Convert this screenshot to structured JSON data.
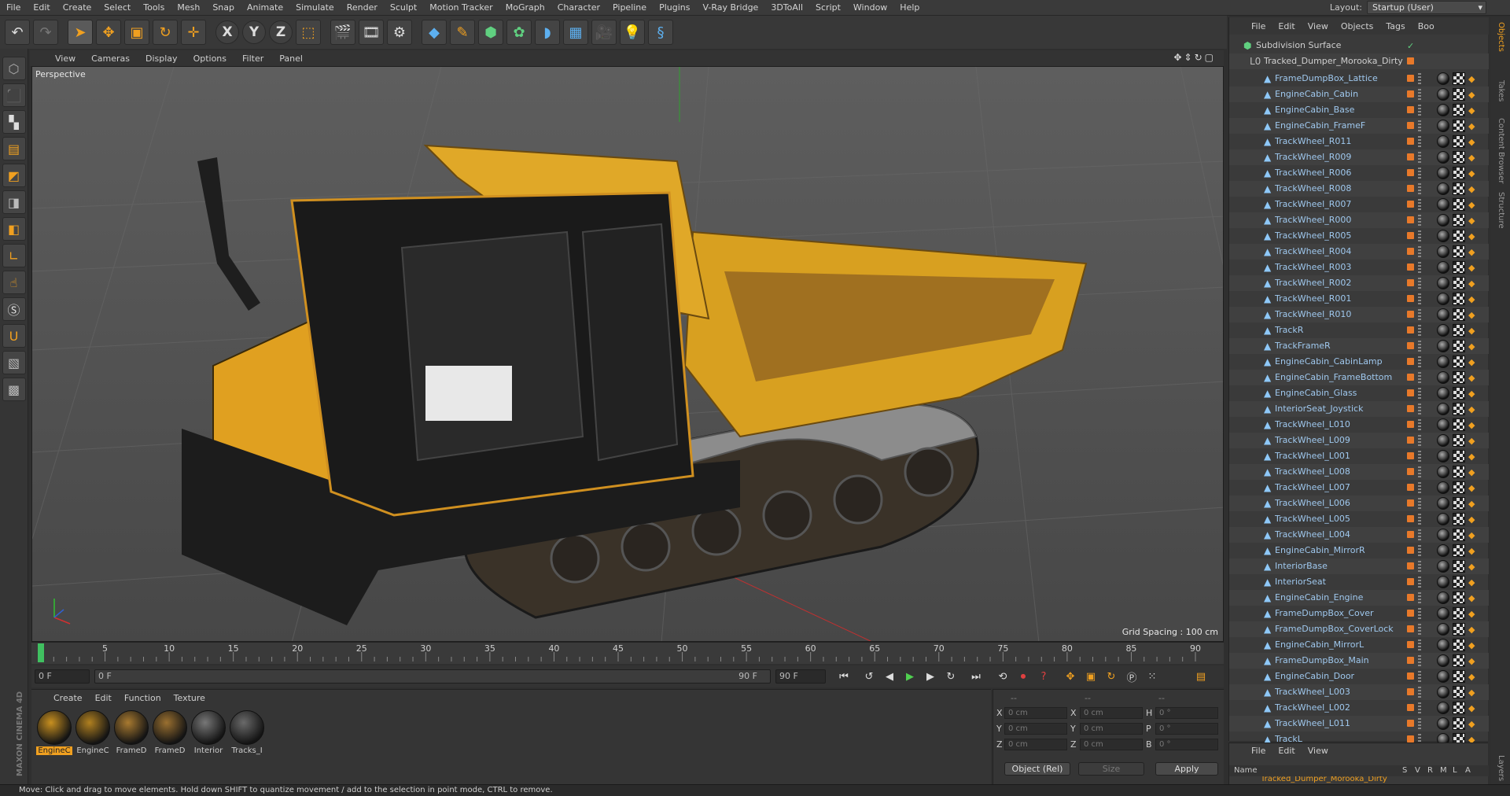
{
  "menubar": {
    "items": [
      "File",
      "Edit",
      "Create",
      "Select",
      "Tools",
      "Mesh",
      "Snap",
      "Animate",
      "Simulate",
      "Render",
      "Sculpt",
      "Motion Tracker",
      "MoGraph",
      "Character",
      "Pipeline",
      "Plugins",
      "V-Ray Bridge",
      "3DToAll",
      "Script",
      "Window",
      "Help"
    ],
    "layout_label": "Layout:",
    "layout_value": "Startup (User)"
  },
  "toolbar": {
    "icons": [
      "undo-icon",
      "redo-icon",
      "select-arrow-icon",
      "move-icon",
      "scale-icon",
      "rotate-icon",
      "live-select-icon",
      "x-axis-icon",
      "y-axis-icon",
      "z-axis-icon",
      "coordinate-system-icon",
      "render-view-icon",
      "render-picture-viewer-icon",
      "render-settings-icon",
      "cube-icon",
      "pen-icon",
      "subdivision-icon",
      "cloner-icon",
      "deformer-icon",
      "floor-icon",
      "camera-icon",
      "light-icon",
      "python-icon"
    ],
    "axis_x": "X",
    "axis_y": "Y",
    "axis_z": "Z"
  },
  "viewport": {
    "menu": [
      "View",
      "Cameras",
      "Display",
      "Options",
      "Filter",
      "Panel"
    ],
    "label": "Perspective",
    "grid_spacing": "Grid Spacing : 100 cm"
  },
  "timeline": {
    "ticks": [
      "0",
      "5",
      "10",
      "15",
      "20",
      "25",
      "30",
      "35",
      "40",
      "45",
      "50",
      "55",
      "60",
      "65",
      "70",
      "75",
      "80",
      "85",
      "90"
    ],
    "current_frame": "0 F",
    "start_field": "0 F",
    "range_start": "0 F",
    "range_end": "90 F",
    "end_field": "90 F",
    "current_field": "0 F"
  },
  "materials": {
    "menu": [
      "Create",
      "Edit",
      "Function",
      "Texture"
    ],
    "items": [
      {
        "name": "EngineC",
        "color": "#c89020",
        "selected": true
      },
      {
        "name": "EngineC",
        "color": "#b08020",
        "selected": false
      },
      {
        "name": "FrameD",
        "color": "#a87a30",
        "selected": false
      },
      {
        "name": "FrameD",
        "color": "#9a7030",
        "selected": false
      },
      {
        "name": "Interior",
        "color": "#777777",
        "selected": false
      },
      {
        "name": "Tracks_I",
        "color": "#6a6a6a",
        "selected": false
      }
    ]
  },
  "coordinates": {
    "header_left": "--",
    "header_mid": "--",
    "header_right": "--",
    "rows": [
      {
        "a": "X",
        "av": "0 cm",
        "b": "X",
        "bv": "0 cm",
        "c": "H",
        "cv": "0 °"
      },
      {
        "a": "Y",
        "av": "0 cm",
        "b": "Y",
        "bv": "0 cm",
        "c": "P",
        "cv": "0 °"
      },
      {
        "a": "Z",
        "av": "0 cm",
        "b": "Z",
        "bv": "0 cm",
        "c": "B",
        "cv": "0 °"
      }
    ],
    "mode": "Object (Rel)",
    "size_mode": "Size",
    "apply": "Apply"
  },
  "object_manager": {
    "menu": [
      "File",
      "Edit",
      "View",
      "Objects",
      "Tags",
      "Boo"
    ],
    "root": "Subdivision Surface",
    "group": "Tracked_Dumper_Morooka_Dirty",
    "objects": [
      "FrameDumpBox_Lattice",
      "EngineCabin_Cabin",
      "EngineCabin_Base",
      "EngineCabin_FrameF",
      "TrackWheel_R011",
      "TrackWheel_R009",
      "TrackWheel_R006",
      "TrackWheel_R008",
      "TrackWheel_R007",
      "TrackWheel_R000",
      "TrackWheel_R005",
      "TrackWheel_R004",
      "TrackWheel_R003",
      "TrackWheel_R002",
      "TrackWheel_R001",
      "TrackWheel_R010",
      "TrackR",
      "TrackFrameR",
      "EngineCabin_CabinLamp",
      "EngineCabin_FrameBottom",
      "EngineCabin_Glass",
      "InteriorSeat_Joystick",
      "TrackWheel_L010",
      "TrackWheel_L009",
      "TrackWheel_L001",
      "TrackWheel_L008",
      "TrackWheel_L007",
      "TrackWheel_L006",
      "TrackWheel_L005",
      "TrackWheel_L004",
      "EngineCabin_MirrorR",
      "InteriorBase",
      "InteriorSeat",
      "EngineCabin_Engine",
      "FrameDumpBox_Cover",
      "FrameDumpBox_CoverLock",
      "EngineCabin_MirrorL",
      "FrameDumpBox_Main",
      "EngineCabin_Door",
      "TrackWheel_L003",
      "TrackWheel_L002",
      "TrackWheel_L011",
      "TrackL"
    ]
  },
  "layer_manager": {
    "menu": [
      "File",
      "Edit",
      "View"
    ],
    "columns": [
      "Name",
      "S",
      "V",
      "R",
      "M",
      "L",
      "A"
    ],
    "row": "Tracked_Dumper_Morooka_Dirty"
  },
  "side_tabs": [
    "Objects",
    "Takes",
    "Content Browser",
    "Structure",
    "Layers"
  ],
  "status": "Move: Click and drag to move elements. Hold down SHIFT to quantize movement / add to the selection in point mode, CTRL to remove.",
  "branding": "MAXON CINEMA 4D",
  "colors": {
    "accent": "#f0a020",
    "object_text": "#9fc8ee",
    "background": "#3a3a3a"
  }
}
